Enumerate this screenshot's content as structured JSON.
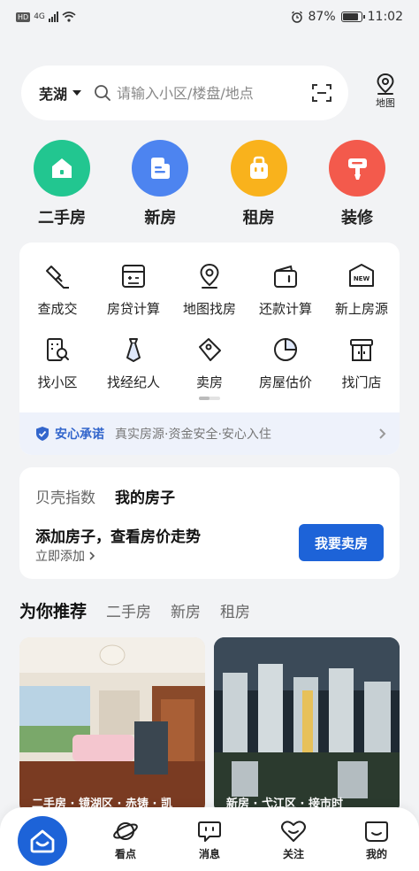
{
  "status_bar": {
    "left_badges": [
      "HD",
      "4G"
    ],
    "battery_percent": "87%",
    "battery_level": 0.87,
    "time": "11:02"
  },
  "search": {
    "city": "芜湖",
    "placeholder": "请输入小区/楼盘/地点",
    "map_label": "地图"
  },
  "categories": [
    {
      "label": "二手房",
      "color": "#22c690",
      "icon": "house-icon"
    },
    {
      "label": "新房",
      "color": "#4d84f0",
      "icon": "new-house-icon"
    },
    {
      "label": "租房",
      "color": "#f9b21c",
      "icon": "rent-bag-icon"
    },
    {
      "label": "装修",
      "color": "#f35a4c",
      "icon": "paint-roller-icon"
    }
  ],
  "tools": [
    {
      "label": "查成交",
      "icon": "gavel-icon"
    },
    {
      "label": "房贷计算",
      "icon": "calculator-icon"
    },
    {
      "label": "地图找房",
      "icon": "map-pin-icon"
    },
    {
      "label": "还款计算",
      "icon": "wallet-icon"
    },
    {
      "label": "新上房源",
      "icon": "new-badge-icon"
    },
    {
      "label": "找小区",
      "icon": "building-search-icon"
    },
    {
      "label": "找经纪人",
      "icon": "agent-tie-icon"
    },
    {
      "label": "卖房",
      "icon": "price-tag-icon"
    },
    {
      "label": "房屋估价",
      "icon": "pie-chart-icon"
    },
    {
      "label": "找门店",
      "icon": "store-icon"
    }
  ],
  "new_badge_text": "NEW",
  "promise": {
    "title": "安心承诺",
    "text": "真实房源·资金安全·安心入住"
  },
  "index_card": {
    "tabs": [
      "贝壳指数",
      "我的房子"
    ],
    "title": "添加房子，查看房价走势",
    "subtitle": "立即添加",
    "button": "我要卖房"
  },
  "recommend": {
    "title": "为你推荐",
    "tabs": [
      "二手房",
      "新房",
      "租房"
    ],
    "cards": [
      {
        "caption": "二手房 · 镜湖区 · 赤铸 · 凯"
      },
      {
        "caption": "新房 · 弋江区 · 接市时"
      }
    ]
  },
  "bottom_nav": {
    "items": [
      {
        "label": "看点",
        "icon": "planet-icon"
      },
      {
        "label": "消息",
        "icon": "message-icon"
      },
      {
        "label": "关注",
        "icon": "heart-icon"
      },
      {
        "label": "我的",
        "icon": "smile-face-icon"
      }
    ]
  },
  "colors": {
    "primary": "#1d63d8",
    "promise_bg": "#eef2fb",
    "promise_text": "#3366cc"
  }
}
